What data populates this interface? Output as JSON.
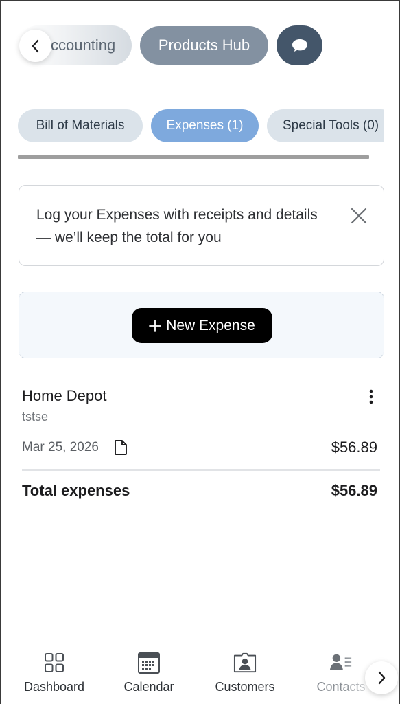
{
  "modules": {
    "accounting_label": "ccounting",
    "products_label": "Products Hub"
  },
  "tabs": [
    {
      "label": "Bill of Materials",
      "active": false
    },
    {
      "label": "Expenses (1)",
      "active": true
    },
    {
      "label": "Special Tools (0)",
      "active": false
    }
  ],
  "banner": {
    "text": "Log your Expenses with receipts and details — we’ll keep the total for you"
  },
  "add_button": {
    "label": "New Expense"
  },
  "expenses": [
    {
      "vendor": "Home Depot",
      "description": "tstse",
      "date": "Mar 25, 2026",
      "amount": "$56.89"
    }
  ],
  "totals": {
    "label": "Total expenses",
    "amount": "$56.89"
  },
  "bottom_nav": [
    {
      "label": "Dashboard",
      "icon": "grid-icon"
    },
    {
      "label": "Calendar",
      "icon": "calendar-icon"
    },
    {
      "label": "Customers",
      "icon": "customer-card-icon"
    },
    {
      "label": "Contacts",
      "icon": "contacts-icon"
    }
  ],
  "colors": {
    "active_tab": "#7ea9dd",
    "inactive_tab": "#dbe3ea",
    "products_chip": "#8391a1",
    "chat_chip": "#44566a",
    "primary_button": "#000000"
  }
}
